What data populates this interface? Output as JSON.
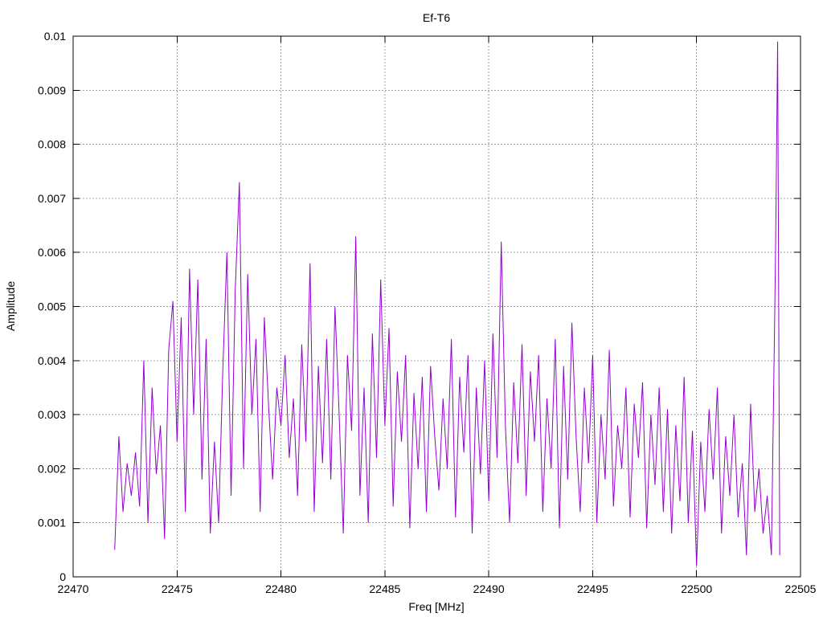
{
  "chart_data": {
    "type": "line",
    "title": "Ef-T6",
    "xlabel": "Freq [MHz]",
    "ylabel": "Amplitude",
    "xlim": [
      22470,
      22505
    ],
    "ylim": [
      0,
      0.01
    ],
    "grid": true,
    "legend": "none",
    "x_ticks": [
      "22470",
      "22475",
      "22480",
      "22485",
      "22490",
      "22495",
      "22500",
      "22505"
    ],
    "y_ticks": [
      "0",
      "0.001",
      "0.002",
      "0.003",
      "0.004",
      "0.005",
      "0.006",
      "0.007",
      "0.008",
      "0.009",
      "0.01"
    ],
    "series": [
      {
        "color": "#9400d3",
        "points": [
          [
            22472.0,
            0.0005
          ],
          [
            22472.2,
            0.0026
          ],
          [
            22472.4,
            0.0012
          ],
          [
            22472.6,
            0.0021
          ],
          [
            22472.8,
            0.0015
          ],
          [
            22473.0,
            0.0023
          ],
          [
            22473.2,
            0.0013
          ],
          [
            22473.4,
            0.004
          ],
          [
            22473.6,
            0.001
          ],
          [
            22473.8,
            0.0035
          ],
          [
            22474.0,
            0.0019
          ],
          [
            22474.2,
            0.0028
          ],
          [
            22474.4,
            0.0007
          ],
          [
            22474.6,
            0.0042
          ],
          [
            22474.8,
            0.0051
          ],
          [
            22475.0,
            0.0025
          ],
          [
            22475.2,
            0.0048
          ],
          [
            22475.4,
            0.0012
          ],
          [
            22475.6,
            0.0057
          ],
          [
            22475.8,
            0.003
          ],
          [
            22476.0,
            0.0055
          ],
          [
            22476.2,
            0.0018
          ],
          [
            22476.4,
            0.0044
          ],
          [
            22476.6,
            0.0008
          ],
          [
            22476.8,
            0.0025
          ],
          [
            22477.0,
            0.001
          ],
          [
            22477.2,
            0.0038
          ],
          [
            22477.4,
            0.006
          ],
          [
            22477.6,
            0.0015
          ],
          [
            22477.8,
            0.0053
          ],
          [
            22478.0,
            0.0073
          ],
          [
            22478.2,
            0.002
          ],
          [
            22478.4,
            0.0056
          ],
          [
            22478.6,
            0.003
          ],
          [
            22478.8,
            0.0044
          ],
          [
            22479.0,
            0.0012
          ],
          [
            22479.2,
            0.0048
          ],
          [
            22479.4,
            0.0032
          ],
          [
            22479.6,
            0.0018
          ],
          [
            22479.8,
            0.0035
          ],
          [
            22480.0,
            0.0028
          ],
          [
            22480.2,
            0.0041
          ],
          [
            22480.4,
            0.0022
          ],
          [
            22480.6,
            0.0033
          ],
          [
            22480.8,
            0.0015
          ],
          [
            22481.0,
            0.0043
          ],
          [
            22481.2,
            0.0025
          ],
          [
            22481.4,
            0.0058
          ],
          [
            22481.6,
            0.0012
          ],
          [
            22481.8,
            0.0039
          ],
          [
            22482.0,
            0.0021
          ],
          [
            22482.2,
            0.0044
          ],
          [
            22482.4,
            0.0018
          ],
          [
            22482.6,
            0.005
          ],
          [
            22482.8,
            0.003
          ],
          [
            22483.0,
            0.0008
          ],
          [
            22483.2,
            0.0041
          ],
          [
            22483.4,
            0.0027
          ],
          [
            22483.6,
            0.0063
          ],
          [
            22483.8,
            0.0015
          ],
          [
            22484.0,
            0.0035
          ],
          [
            22484.2,
            0.001
          ],
          [
            22484.4,
            0.0045
          ],
          [
            22484.6,
            0.0022
          ],
          [
            22484.8,
            0.0055
          ],
          [
            22485.0,
            0.0028
          ],
          [
            22485.2,
            0.0046
          ],
          [
            22485.4,
            0.0013
          ],
          [
            22485.6,
            0.0038
          ],
          [
            22485.8,
            0.0025
          ],
          [
            22486.0,
            0.0041
          ],
          [
            22486.2,
            0.0009
          ],
          [
            22486.4,
            0.0034
          ],
          [
            22486.6,
            0.002
          ],
          [
            22486.8,
            0.0037
          ],
          [
            22487.0,
            0.0012
          ],
          [
            22487.2,
            0.0039
          ],
          [
            22487.4,
            0.0026
          ],
          [
            22487.6,
            0.0016
          ],
          [
            22487.8,
            0.0033
          ],
          [
            22488.0,
            0.002
          ],
          [
            22488.2,
            0.0044
          ],
          [
            22488.4,
            0.0011
          ],
          [
            22488.6,
            0.0037
          ],
          [
            22488.8,
            0.0023
          ],
          [
            22489.0,
            0.0041
          ],
          [
            22489.2,
            0.0008
          ],
          [
            22489.4,
            0.0035
          ],
          [
            22489.6,
            0.0019
          ],
          [
            22489.8,
            0.004
          ],
          [
            22490.0,
            0.0014
          ],
          [
            22490.2,
            0.0045
          ],
          [
            22490.4,
            0.0022
          ],
          [
            22490.6,
            0.0062
          ],
          [
            22490.8,
            0.0028
          ],
          [
            22491.0,
            0.001
          ],
          [
            22491.2,
            0.0036
          ],
          [
            22491.4,
            0.0021
          ],
          [
            22491.6,
            0.0043
          ],
          [
            22491.8,
            0.0015
          ],
          [
            22492.0,
            0.0038
          ],
          [
            22492.2,
            0.0025
          ],
          [
            22492.4,
            0.0041
          ],
          [
            22492.6,
            0.0012
          ],
          [
            22492.8,
            0.0033
          ],
          [
            22493.0,
            0.002
          ],
          [
            22493.2,
            0.0044
          ],
          [
            22493.4,
            0.0009
          ],
          [
            22493.6,
            0.0039
          ],
          [
            22493.8,
            0.0018
          ],
          [
            22494.0,
            0.0047
          ],
          [
            22494.2,
            0.0026
          ],
          [
            22494.4,
            0.0012
          ],
          [
            22494.6,
            0.0035
          ],
          [
            22494.8,
            0.0021
          ],
          [
            22495.0,
            0.0041
          ],
          [
            22495.2,
            0.001
          ],
          [
            22495.4,
            0.003
          ],
          [
            22495.6,
            0.0018
          ],
          [
            22495.8,
            0.0042
          ],
          [
            22496.0,
            0.0013
          ],
          [
            22496.2,
            0.0028
          ],
          [
            22496.4,
            0.002
          ],
          [
            22496.6,
            0.0035
          ],
          [
            22496.8,
            0.0011
          ],
          [
            22497.0,
            0.0032
          ],
          [
            22497.2,
            0.0022
          ],
          [
            22497.4,
            0.0036
          ],
          [
            22497.6,
            0.0009
          ],
          [
            22497.8,
            0.003
          ],
          [
            22498.0,
            0.0017
          ],
          [
            22498.2,
            0.0035
          ],
          [
            22498.4,
            0.0012
          ],
          [
            22498.6,
            0.0031
          ],
          [
            22498.8,
            0.0008
          ],
          [
            22499.0,
            0.0028
          ],
          [
            22499.2,
            0.0014
          ],
          [
            22499.4,
            0.0037
          ],
          [
            22499.6,
            0.001
          ],
          [
            22499.8,
            0.0027
          ],
          [
            22500.0,
            0.0002
          ],
          [
            22500.2,
            0.0025
          ],
          [
            22500.4,
            0.0012
          ],
          [
            22500.6,
            0.0031
          ],
          [
            22500.8,
            0.0018
          ],
          [
            22501.0,
            0.0035
          ],
          [
            22501.2,
            0.0008
          ],
          [
            22501.4,
            0.0026
          ],
          [
            22501.6,
            0.0015
          ],
          [
            22501.8,
            0.003
          ],
          [
            22502.0,
            0.0011
          ],
          [
            22502.2,
            0.0021
          ],
          [
            22502.4,
            0.0004
          ],
          [
            22502.6,
            0.0032
          ],
          [
            22502.8,
            0.0012
          ],
          [
            22503.0,
            0.002
          ],
          [
            22503.2,
            0.0008
          ],
          [
            22503.4,
            0.0015
          ],
          [
            22503.6,
            0.0004
          ],
          [
            22503.8,
            0.006
          ],
          [
            22503.9,
            0.0099
          ],
          [
            22504.0,
            0.0004
          ]
        ]
      }
    ]
  }
}
